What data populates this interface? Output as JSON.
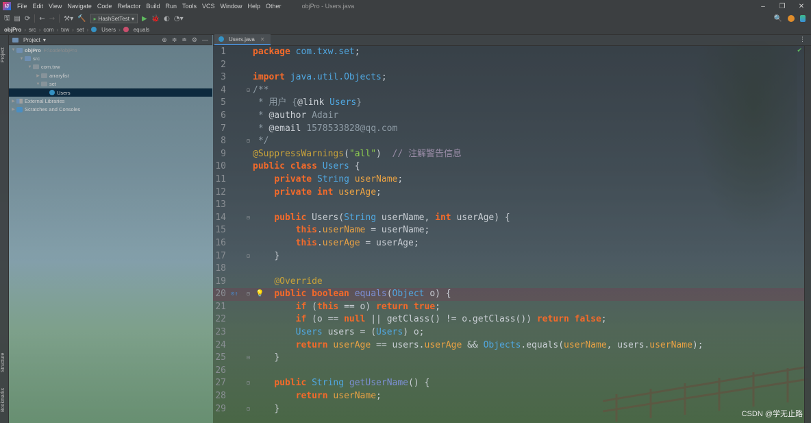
{
  "window": {
    "title": "objPro - Users.java",
    "app_icon": "IJ"
  },
  "menu": [
    "File",
    "Edit",
    "View",
    "Navigate",
    "Code",
    "Refactor",
    "Build",
    "Run",
    "Tools",
    "VCS",
    "Window",
    "Help",
    "Other"
  ],
  "toolbar": {
    "run_config": "HashSetTest"
  },
  "breadcrumb": [
    "objPro",
    "src",
    "com",
    "txw",
    "set",
    "Users",
    "equals"
  ],
  "project_panel": {
    "title": "Project",
    "tree": [
      {
        "label": "objPro",
        "hint": "F:\\code\\objPro",
        "depth": 0
      },
      {
        "label": "src",
        "depth": 1
      },
      {
        "label": "com.txw",
        "depth": 2
      },
      {
        "label": "arrarylist",
        "depth": 3
      },
      {
        "label": "set",
        "depth": 3
      },
      {
        "label": "Users",
        "depth": 4
      },
      {
        "label": "External Libraries",
        "depth": 0
      },
      {
        "label": "Scratches and Consoles",
        "depth": 0
      }
    ]
  },
  "side_labels": {
    "project": "Project",
    "structure": "Structure",
    "bookmarks": "Bookmarks"
  },
  "editor": {
    "tab": "Users.java",
    "line_numbers": [
      "1",
      "2",
      "3",
      "4",
      "5",
      "6",
      "7",
      "8",
      "9",
      "10",
      "11",
      "12",
      "13",
      "14",
      "15",
      "16",
      "17",
      "18",
      "19",
      "20",
      "21",
      "22",
      "23",
      "24",
      "25",
      "26",
      "27",
      "28",
      "29"
    ]
  },
  "code": {
    "l1": [
      "package ",
      "com.txw.set",
      ";"
    ],
    "l3": [
      "import ",
      "java.util.Objects",
      ";"
    ],
    "l4": "/**",
    "l5": [
      " * 用户 {",
      "@link ",
      "Users",
      "}"
    ],
    "l6": [
      " * ",
      "@author ",
      "Adair"
    ],
    "l7": [
      " * ",
      "@email ",
      "1578533828@qq.com"
    ],
    "l8": " */",
    "l9": [
      "@SuppressWarnings",
      "(",
      "\"all\"",
      ")  ",
      "// 注解警告信息"
    ],
    "l10": [
      "public class ",
      "Users",
      " {"
    ],
    "l11": [
      "private ",
      "String ",
      "userName",
      ";"
    ],
    "l12": [
      "private int ",
      "userAge",
      ";"
    ],
    "l14": [
      "public ",
      "Users(",
      "String ",
      "userName, ",
      "int ",
      "userAge) {"
    ],
    "l15": [
      "this",
      ".",
      "userName",
      " = userName;"
    ],
    "l16": [
      "this",
      ".",
      "userAge",
      " = userAge;"
    ],
    "l17": "}",
    "l19": "@Override",
    "l20": [
      "public boolean ",
      "equals",
      "(",
      "Object ",
      "o) {"
    ],
    "l21": [
      "if ",
      "(",
      "this ",
      "== o) ",
      "return true",
      ";"
    ],
    "l22": [
      "if ",
      "(o == ",
      "null ",
      "|| getClass() != o.getClass()) ",
      "return false",
      ";"
    ],
    "l23": [
      "Users ",
      "users = (",
      "Users",
      ") o;"
    ],
    "l24": [
      "return ",
      "userAge",
      " == users.",
      "userAge",
      " && ",
      "Objects",
      ".equals(",
      "userName",
      ", users.",
      "userName",
      ");"
    ],
    "l25": "}",
    "l27": [
      "public ",
      "String ",
      "getUserName",
      "() {"
    ],
    "l28": [
      "return ",
      "userName",
      ";"
    ],
    "l29": "}"
  },
  "watermark": "CSDN @学无止路"
}
